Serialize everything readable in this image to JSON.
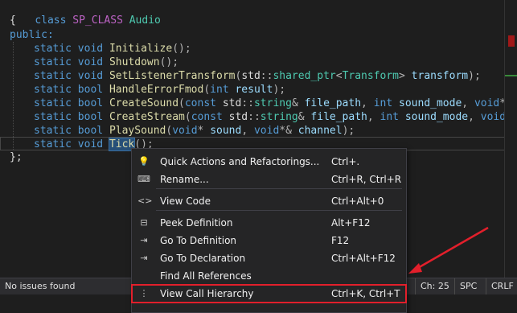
{
  "code": {
    "line1": {
      "kw": "class",
      "macro": "SP_CLASS",
      "name": "Audio"
    },
    "open_brace": "{",
    "access": "public:",
    "members": [
      {
        "qual": "static",
        "type": "void",
        "name": "Initialize",
        "params": "();"
      },
      {
        "qual": "static",
        "type": "void",
        "name": "Shutdown",
        "params": "();"
      },
      {
        "qual": "static",
        "type": "void",
        "name": "SetListenerTransform",
        "params_html": [
          {
            "t": "(",
            "c": "punc"
          },
          {
            "t": "std",
            "c": "plain"
          },
          {
            "t": "::",
            "c": "punc"
          },
          {
            "t": "shared_ptr",
            "c": "ty"
          },
          {
            "t": "<",
            "c": "punc"
          },
          {
            "t": "Transform",
            "c": "ty"
          },
          {
            "t": "> ",
            "c": "punc"
          },
          {
            "t": "transform",
            "c": "param"
          },
          {
            "t": ");",
            "c": "punc"
          }
        ]
      },
      {
        "qual": "static",
        "type": "bool",
        "name": "HandleErrorFmod",
        "params_html": [
          {
            "t": "(",
            "c": "punc"
          },
          {
            "t": "int",
            "c": "kw"
          },
          {
            "t": " result",
            "c": "param"
          },
          {
            "t": ");",
            "c": "punc"
          }
        ]
      },
      {
        "qual": "static",
        "type": "bool",
        "name": "CreateSound",
        "params_html": [
          {
            "t": "(",
            "c": "punc"
          },
          {
            "t": "const",
            "c": "kw"
          },
          {
            "t": " std",
            "c": "plain"
          },
          {
            "t": "::",
            "c": "punc"
          },
          {
            "t": "string",
            "c": "ty"
          },
          {
            "t": "& ",
            "c": "punc"
          },
          {
            "t": "file_path",
            "c": "param"
          },
          {
            "t": ", ",
            "c": "punc"
          },
          {
            "t": "int",
            "c": "kw"
          },
          {
            "t": " sound_mode",
            "c": "param"
          },
          {
            "t": ", ",
            "c": "punc"
          },
          {
            "t": "void",
            "c": "kw"
          },
          {
            "t": "*&",
            "c": "punc"
          }
        ]
      },
      {
        "qual": "static",
        "type": "bool",
        "name": "CreateStream",
        "params_html": [
          {
            "t": "(",
            "c": "punc"
          },
          {
            "t": "const",
            "c": "kw"
          },
          {
            "t": " std",
            "c": "plain"
          },
          {
            "t": "::",
            "c": "punc"
          },
          {
            "t": "string",
            "c": "ty"
          },
          {
            "t": "& ",
            "c": "punc"
          },
          {
            "t": "file_path",
            "c": "param"
          },
          {
            "t": ", ",
            "c": "punc"
          },
          {
            "t": "int",
            "c": "kw"
          },
          {
            "t": " sound_mode",
            "c": "param"
          },
          {
            "t": ", ",
            "c": "punc"
          },
          {
            "t": "void",
            "c": "kw"
          },
          {
            "t": "*&",
            "c": "punc"
          }
        ]
      },
      {
        "qual": "static",
        "type": "bool",
        "name": "PlaySound",
        "params_html": [
          {
            "t": "(",
            "c": "punc"
          },
          {
            "t": "void",
            "c": "kw"
          },
          {
            "t": "* ",
            "c": "punc"
          },
          {
            "t": "sound",
            "c": "param"
          },
          {
            "t": ", ",
            "c": "punc"
          },
          {
            "t": "void",
            "c": "kw"
          },
          {
            "t": "*& ",
            "c": "punc"
          },
          {
            "t": "channel",
            "c": "param"
          },
          {
            "t": ");",
            "c": "punc"
          }
        ]
      },
      {
        "qual": "static",
        "type": "void",
        "name": "Tick",
        "params": "();"
      }
    ],
    "close": "};"
  },
  "context_menu": {
    "items": [
      {
        "icon": "lightbulb-icon",
        "glyph": "💡",
        "label": "Quick Actions and Refactorings...",
        "shortcut": "Ctrl+."
      },
      {
        "icon": "rename-icon",
        "glyph": "⌨",
        "label": "Rename...",
        "shortcut": "Ctrl+R, Ctrl+R"
      },
      {
        "icon": "view-code-icon",
        "glyph": "<>",
        "label": "View Code",
        "shortcut": "Ctrl+Alt+0"
      },
      {
        "icon": "peek-definition-icon",
        "glyph": "⊟",
        "label": "Peek Definition",
        "shortcut": "Alt+F12"
      },
      {
        "icon": "go-to-definition-icon",
        "glyph": "⇥",
        "label": "Go To Definition",
        "shortcut": "F12"
      },
      {
        "icon": "go-to-declaration-icon",
        "glyph": "⇥",
        "label": "Go To Declaration",
        "shortcut": "Ctrl+Alt+F12"
      },
      {
        "icon": "",
        "glyph": "",
        "label": "Find All References",
        "shortcut": ""
      },
      {
        "icon": "call-hierarchy-icon",
        "glyph": "⋮",
        "label": "View Call Hierarchy",
        "shortcut": "Ctrl+K, Ctrl+T"
      }
    ]
  },
  "status_bar": {
    "issues": "No issues found",
    "column": "Ch: 25",
    "whitespace": "SPC",
    "line_ending": "CRLF"
  },
  "colors": {
    "highlight_outline": "#e21f2b",
    "arrow": "#e21f2b"
  }
}
